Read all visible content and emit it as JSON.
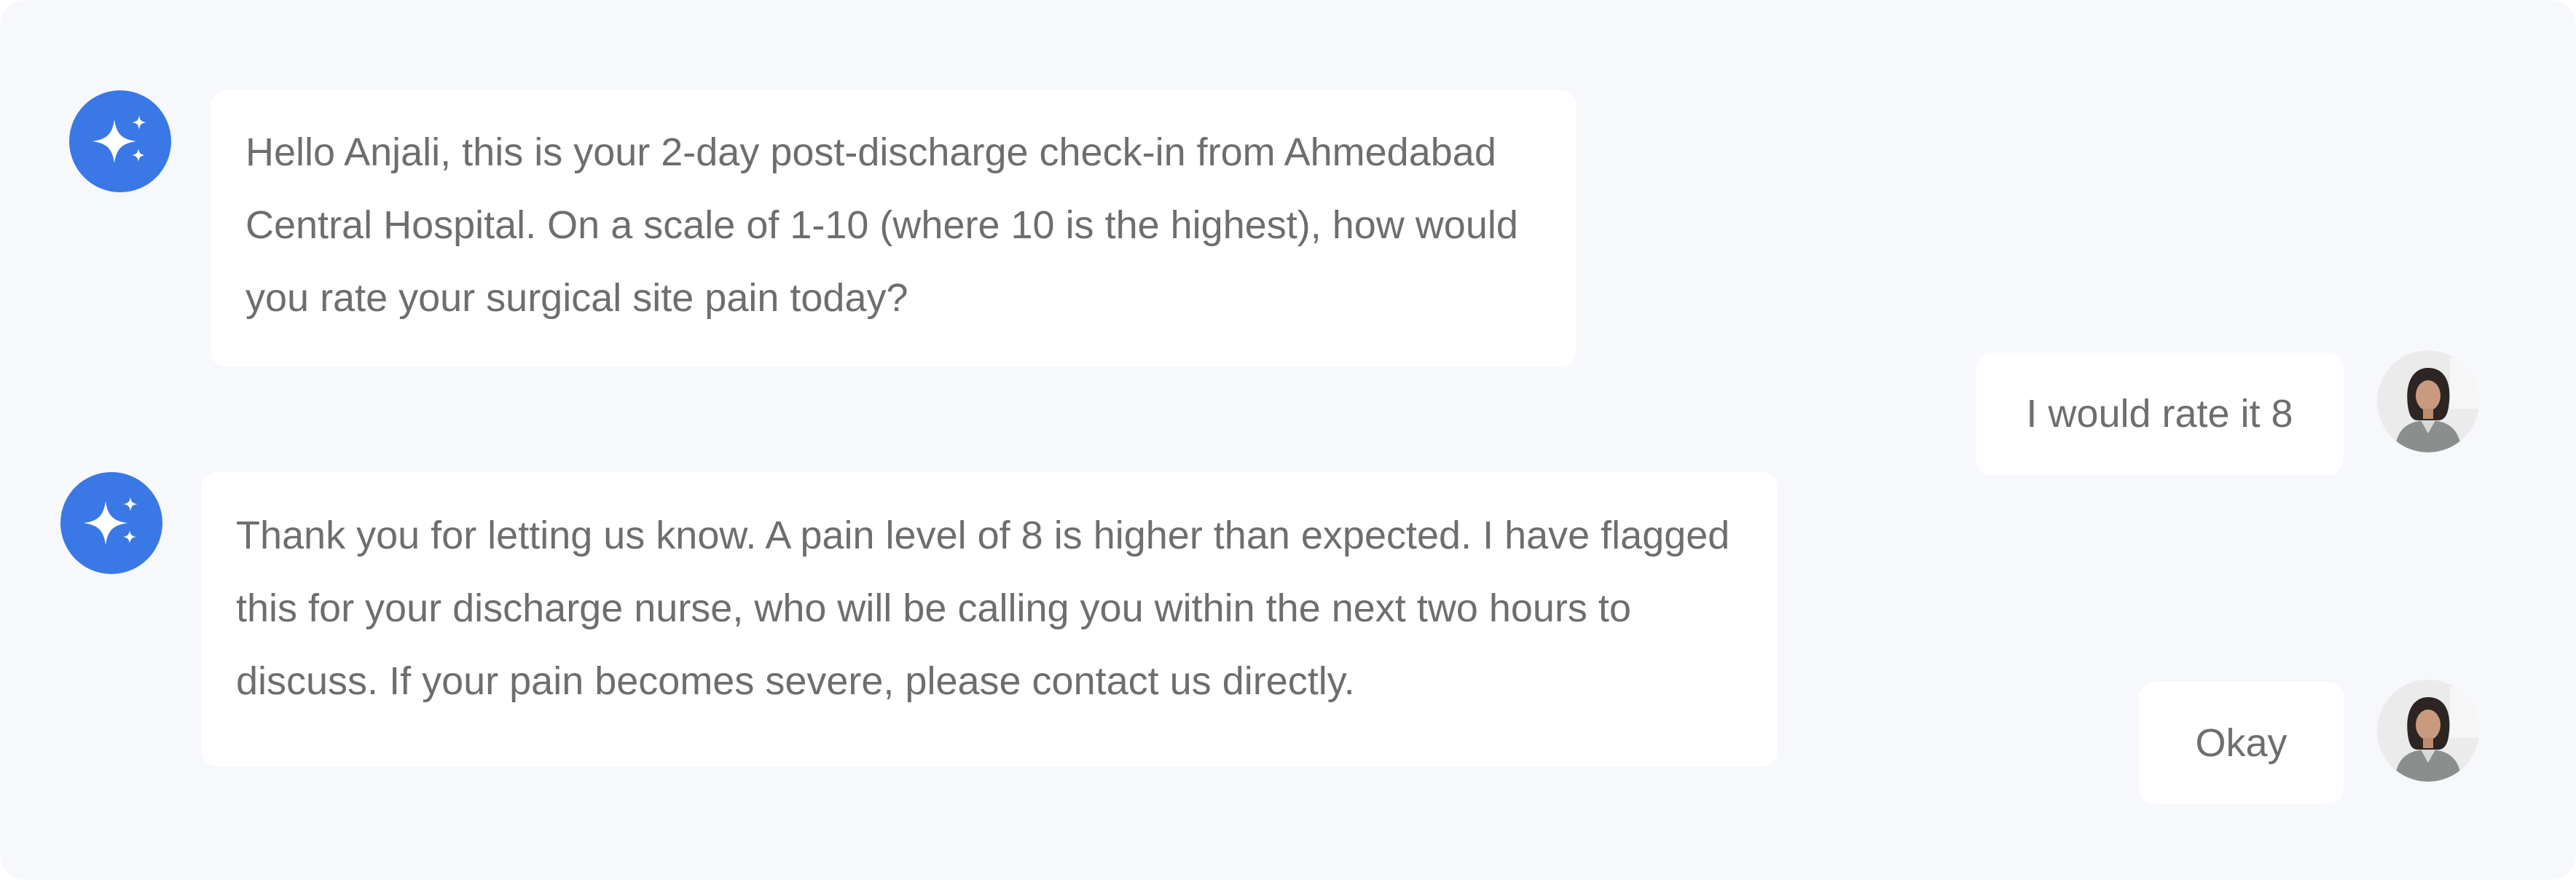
{
  "colors": {
    "background": "#f7f8fb",
    "bubble": "#ffffff",
    "text": "#6e6e6e",
    "accent": "#3a78e6"
  },
  "messages": [
    {
      "sender": "assistant",
      "avatar_icon": "sparkle-icon",
      "text": "Hello Anjali, this is your 2-day post-discharge check-in from Ahmedabad Central Hospital. On a scale of 1-10 (where 10 is the highest), how would you rate your surgical site pain today?"
    },
    {
      "sender": "user",
      "avatar_icon": "user-avatar",
      "text": "I would rate it 8"
    },
    {
      "sender": "assistant",
      "avatar_icon": "sparkle-icon",
      "text": "Thank you for letting us know. A pain level of 8 is higher than expected. I have flagged this for your discharge nurse, who will be calling you within the next two hours to discuss. If your pain becomes severe, please contact us directly."
    },
    {
      "sender": "user",
      "avatar_icon": "user-avatar",
      "text": "Okay"
    }
  ]
}
